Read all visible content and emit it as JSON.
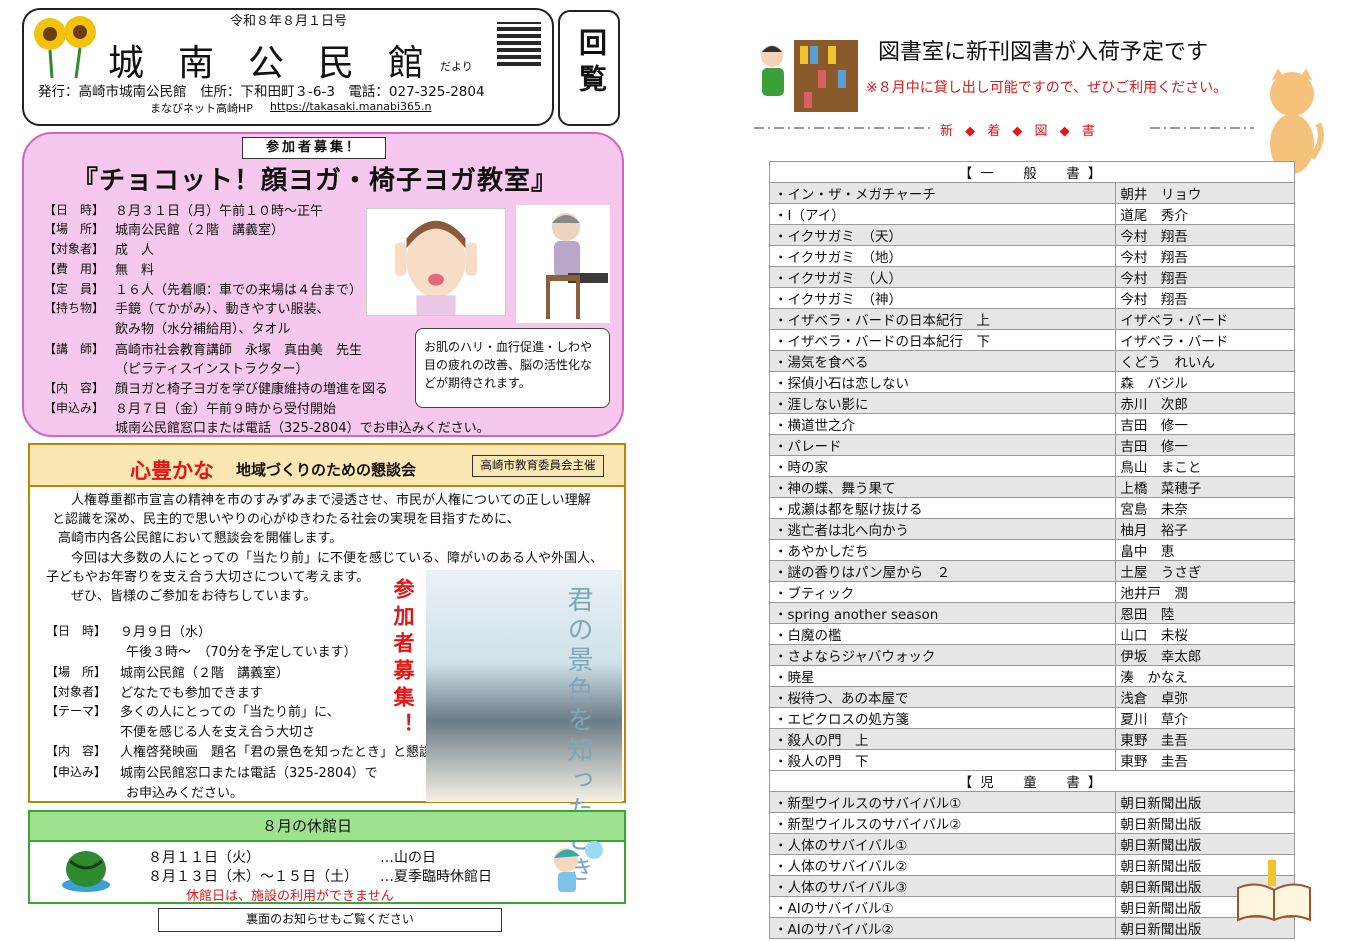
{
  "header": {
    "issue_date": "令和８年８月１日号",
    "title": "城南公民館",
    "title_suffix": "だより",
    "publisher": "発行：高崎市城南公民館　住所：下和田町３-6-3　電話：027-325-2804",
    "web_label": "まなびネット高崎HP",
    "web_url": "https://takasaki.manabi365.n",
    "kairan": "回覧"
  },
  "yoga": {
    "tag": "参加者募集！",
    "title": "『チョコット！顔ヨガ・椅子ヨガ教室』",
    "rows": [
      {
        "label": "【日　時】",
        "value": "８月３１日（月）午前１０時～正午"
      },
      {
        "label": "【場　所】",
        "value": "城南公民館（２階　講義室）"
      },
      {
        "label": "【対象者】",
        "value": "成　人"
      },
      {
        "label": "【費　用】",
        "value": "無　料"
      },
      {
        "label": "【定　員】",
        "value": "１６人（先着順：車での来場は４台まで）"
      },
      {
        "label": "【持ち物】",
        "value": "手鏡（てかがみ）、動きやすい服装、"
      },
      {
        "label": "",
        "value": "飲み物（水分補給用）、タオル"
      },
      {
        "label": "【講　師】",
        "value": "高崎市社会教育講師　永塚　真由美　先生"
      },
      {
        "label": "",
        "value": "（ピラティスインストラクター）"
      },
      {
        "label": "【内　容】",
        "value": "顔ヨガと椅子ヨガを学び健康維持の増進を図る"
      },
      {
        "label": "【申込み】",
        "value": "８月７日（金）午前９時から受付開始"
      },
      {
        "label": "",
        "value": "城南公民館窓口または電話（325-2804）でお申込みください。"
      }
    ],
    "bubble": "お肌のハリ・血行促進・しわや目の疲れの改善、脳の活性化などが期待されます。"
  },
  "meeting": {
    "title_red": "心豊かな",
    "title_rest": "地域づくりのための懇談会",
    "host": "高崎市教育委員会主催",
    "intro": [
      "　人権尊重都市宣言の精神を市のすみずみまで浸透させ、市民が人権についての正しい理解",
      "と認識を深め、民主的で思いやりの心がゆきわたる社会の実現を目指すために、",
      "高崎市内各公民館において懇談会を開催します。",
      "　今回は大多数の人にとっての「当たり前」に不便を感じている、障がいのある人や外国人、",
      "子どもやお年寄りを支え合う大切さについて考えます。",
      "　ぜひ、皆様のご参加をお待ちしています。"
    ],
    "rows": [
      {
        "label": "【日　時】",
        "value": "９月９日（水）"
      },
      {
        "label": "",
        "value": "午後３時～　（70分を予定しています）"
      },
      {
        "label": "【場　所】",
        "value": "城南公民館（２階　講義室）"
      },
      {
        "label": "【対象者】",
        "value": "どなたでも参加できます"
      },
      {
        "label": "【テーマ】",
        "value": "多くの人にとっての「当たり前」に、"
      },
      {
        "label": "",
        "value": "不便を感じる人を支え合う大切さ"
      },
      {
        "label": "【内　容】",
        "value": "人権啓発映画　題名「君の景色を知ったとき」と懇談会"
      },
      {
        "label": "【申込み】",
        "value": "城南公民館窓口または電話（325-2804）で"
      },
      {
        "label": "",
        "value": "お申込みください。"
      }
    ],
    "recruit": "参加者募集！",
    "movie_title": "君の景色を知ったとき"
  },
  "closed": {
    "heading": "８月の休館日",
    "line1_date": "８月１１日（火）",
    "line1_note": "…山の日",
    "line2_date": "８月１３日（木）～１５日（土）",
    "line2_note": "…夏季臨時休館日",
    "note": "休館日は、施設の利用ができません"
  },
  "footer_note": "裏面のお知らせもご覧ください",
  "library": {
    "title": "図書室に新刊図書が入荷予定です",
    "note": "※８月中に貸し出し可能ですので、ぜひご利用ください。",
    "banner": "新 ◆ 着 ◆ 図 ◆ 書",
    "general_heading": "【一　般　書】",
    "general": [
      {
        "title": "・イン・ザ・メガチャーチ",
        "author": "朝井　リョウ"
      },
      {
        "title": "・I（アイ）",
        "author": "道尾　秀介"
      },
      {
        "title": "・イクサガミ　（天）",
        "author": "今村　翔吾"
      },
      {
        "title": "・イクサガミ　（地）",
        "author": "今村　翔吾"
      },
      {
        "title": "・イクサガミ　（人）",
        "author": "今村　翔吾"
      },
      {
        "title": "・イクサガミ　（神）",
        "author": "今村　翔吾"
      },
      {
        "title": "・イザベラ・バードの日本紀行　上",
        "author": "イザベラ・バード"
      },
      {
        "title": "・イザベラ・バードの日本紀行　下",
        "author": "イザベラ・バード"
      },
      {
        "title": "・湯気を食べる",
        "author": "くどう　れいん"
      },
      {
        "title": "・探偵小石は恋しない",
        "author": "森　バジル"
      },
      {
        "title": "・涯しない影に",
        "author": "赤川　次郎"
      },
      {
        "title": "・横道世之介",
        "author": "吉田　修一"
      },
      {
        "title": "・パレード",
        "author": "吉田　修一"
      },
      {
        "title": "・時の家",
        "author": "鳥山　まこと"
      },
      {
        "title": "・神の蝶、舞う果て",
        "author": "上橋　菜穂子"
      },
      {
        "title": "・成瀬は都を駆け抜ける",
        "author": "宮島　未奈"
      },
      {
        "title": "・逃亡者は北へ向かう",
        "author": "柚月　裕子"
      },
      {
        "title": "・あやかしだち",
        "author": "畠中　恵"
      },
      {
        "title": "・謎の香りはパン屋から　２",
        "author": "土屋　うさぎ"
      },
      {
        "title": "・ブティック",
        "author": "池井戸　潤"
      },
      {
        "title": "・spring another season",
        "author": "恩田　陸"
      },
      {
        "title": "・白魔の檻",
        "author": "山口　未桜"
      },
      {
        "title": "・さよならジャバウォック",
        "author": "伊坂　幸太郎"
      },
      {
        "title": "・暁星",
        "author": "湊　かなえ"
      },
      {
        "title": "・桜待つ、あの本屋で",
        "author": "浅倉　卓弥"
      },
      {
        "title": "・エピクロスの処方箋",
        "author": "夏川　草介"
      },
      {
        "title": "・殺人の門　上",
        "author": "東野　圭吾"
      },
      {
        "title": "・殺人の門　下",
        "author": "東野　圭吾"
      }
    ],
    "children_heading": "【児　童　書】",
    "children": [
      {
        "title": "・新型ウイルスのサバイバル①",
        "author": "朝日新聞出版"
      },
      {
        "title": "・新型ウイルスのサバイバル②",
        "author": "朝日新聞出版"
      },
      {
        "title": "・人体のサバイバル①",
        "author": "朝日新聞出版"
      },
      {
        "title": "・人体のサバイバル②",
        "author": "朝日新聞出版"
      },
      {
        "title": "・人体のサバイバル③",
        "author": "朝日新聞出版"
      },
      {
        "title": "・AIのサバイバル①",
        "author": "朝日新聞出版"
      },
      {
        "title": "・AIのサバイバル②",
        "author": "朝日新聞出版"
      }
    ]
  },
  "colors": {
    "accent_red": "#e41515",
    "yoga_pink": "#f6c8ee",
    "meeting_gold": "#b8860b",
    "closed_green": "#9ee28f"
  }
}
